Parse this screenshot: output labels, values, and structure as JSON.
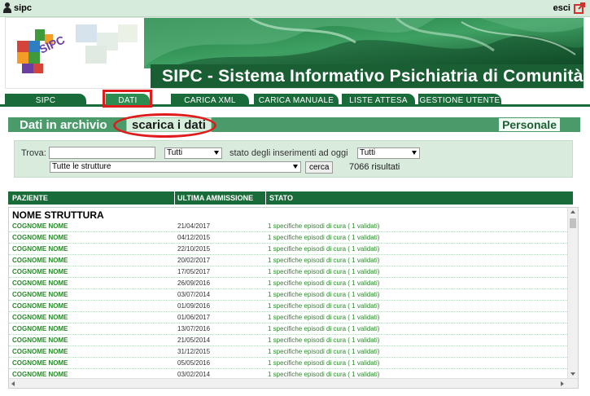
{
  "app": {
    "user": "sipc",
    "logout_label": "esci"
  },
  "banner": {
    "logo_text": "SIPC",
    "title": "SIPC - Sistema Informativo Psichiatria di Comunità"
  },
  "tabs": [
    {
      "label": "SIPC"
    },
    {
      "label": "DATI"
    },
    {
      "label": "CARICA XML"
    },
    {
      "label": "CARICA MANUALE"
    },
    {
      "label": "LISTE ATTESA"
    },
    {
      "label": "GESTIONE UTENTE"
    }
  ],
  "subheader": {
    "title": "Dati in archivio",
    "download_label": "scarica i dati",
    "personal_label": "Personale"
  },
  "search": {
    "find_label": "Trova:",
    "find_value": "",
    "filter_value": "Tutti",
    "state_label": "stato degli inserimenti ad oggi",
    "state_value": "Tutti",
    "structures_value": "Tutte le strutture",
    "search_button": "cerca",
    "result_count": "7066 risultati"
  },
  "table": {
    "headers": [
      "PAZIENTE",
      "ULTIMA AMMISSIONE",
      "STATO"
    ],
    "group_name": "NOME STRUTTURA",
    "rows": [
      {
        "name": "COGNOME NOME",
        "date": "21/04/2017",
        "status": "1 specifiche episodi di cura ( 1 validati)"
      },
      {
        "name": "COGNOME NOME",
        "date": "04/12/2015",
        "status": "1 specifiche episodi di cura ( 1 validati)"
      },
      {
        "name": "COGNOME NOME",
        "date": "22/10/2015",
        "status": "1 specifiche episodi di cura ( 1 validati)"
      },
      {
        "name": "COGNOME NOME",
        "date": "20/02/2017",
        "status": "1 specifiche episodi di cura ( 1 validati)"
      },
      {
        "name": "COGNOME NOME",
        "date": "17/05/2017",
        "status": "1 specifiche episodi di cura ( 1 validati)"
      },
      {
        "name": "COGNOME NOME",
        "date": "26/09/2016",
        "status": "1 specifiche episodi di cura ( 1 validati)"
      },
      {
        "name": "COGNOME NOME",
        "date": "03/07/2014",
        "status": "1 specifiche episodi di cura ( 1 validati)"
      },
      {
        "name": "COGNOME NOME",
        "date": "01/09/2016",
        "status": "1 specifiche episodi di cura ( 1 validati)"
      },
      {
        "name": "COGNOME NOME",
        "date": "01/06/2017",
        "status": "1 specifiche episodi di cura ( 1 validati)"
      },
      {
        "name": "COGNOME NOME",
        "date": "13/07/2016",
        "status": "1 specifiche episodi di cura ( 1 validati)"
      },
      {
        "name": "COGNOME NOME",
        "date": "21/05/2014",
        "status": "1 specifiche episodi di cura ( 1 validati)"
      },
      {
        "name": "COGNOME NOME",
        "date": "31/12/2015",
        "status": "1 specifiche episodi di cura ( 1 validati)"
      },
      {
        "name": "COGNOME NOME",
        "date": "05/05/2016",
        "status": "1 specifiche episodi di cura ( 1 validati)"
      },
      {
        "name": "COGNOME NOME",
        "date": "03/02/2014",
        "status": "1 specifiche episodi di cura ( 1 validati)"
      }
    ]
  },
  "colors": {
    "brand_dark": "#1a5e34",
    "brand": "#1a6b3a",
    "accent": "#4a9a6a",
    "highlight": "#e01b1b",
    "row_text": "#2b8a2b"
  }
}
